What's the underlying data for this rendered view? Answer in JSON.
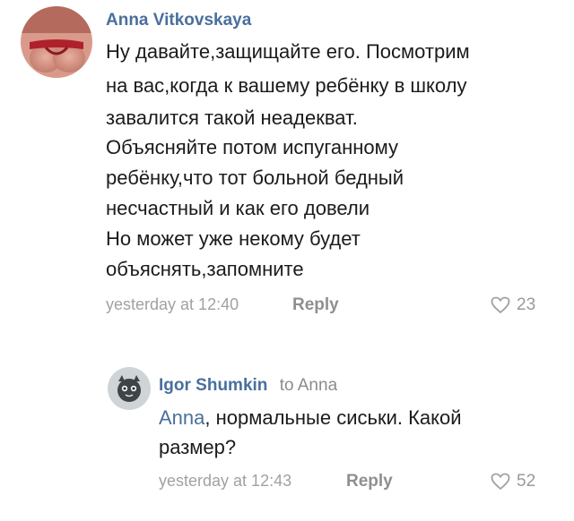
{
  "comments": [
    {
      "author": "Anna Vitkovskaya",
      "lines": [
        "Ну давайте,защищайте его. Посмотрим",
        "на вас,когда к вашему ребёнку в школу",
        "завалится такой неадекват.",
        "Объясняйте потом испуганному",
        "ребёнку,что тот больной бедный",
        "несчастный и как его довели",
        "Но может уже некому будет",
        "объяснять,запомните"
      ],
      "time": "yesterday at 12:40",
      "reply_label": "Reply",
      "likes": "23"
    }
  ],
  "reply": {
    "author": "Igor Shumkin",
    "to_label": "to Anna",
    "mention": "Anna",
    "line1_rest": ", нормальные сиськи. Какой",
    "line2": "размер?",
    "time": "yesterday at 12:43",
    "reply_label": "Reply",
    "likes": "52"
  },
  "colors": {
    "author_link": "#4a6f9c",
    "meta_text": "#a1a1a1",
    "body_text": "#1b1b1b"
  }
}
